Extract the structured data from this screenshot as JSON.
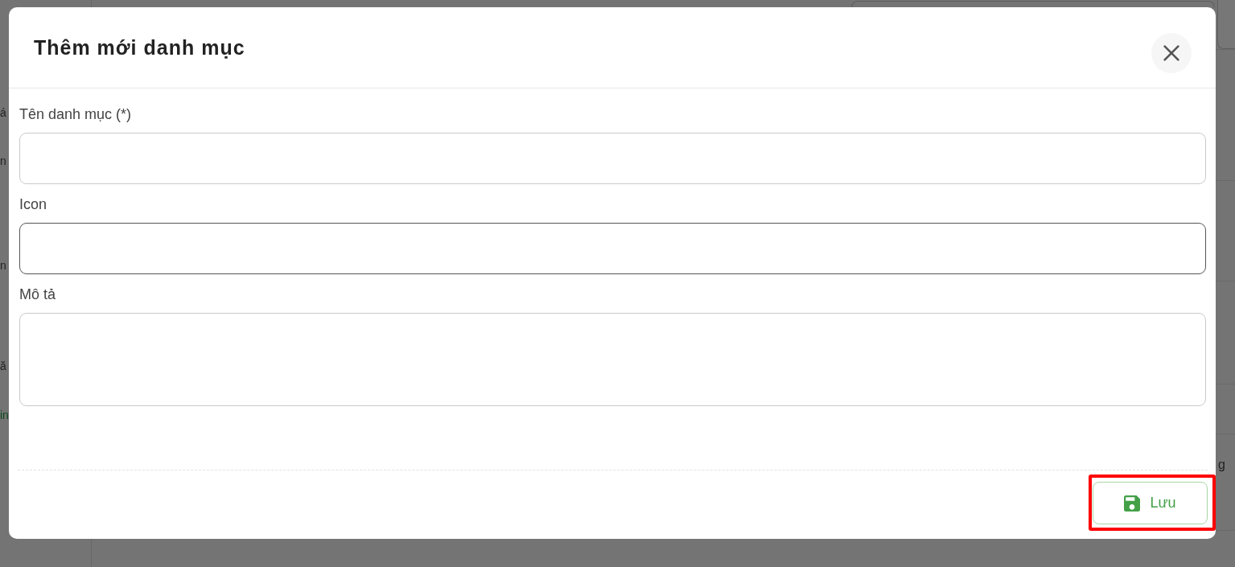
{
  "background": {
    "sidebar_fragments": [
      {
        "text": "á",
        "kind": "text"
      },
      {
        "text": "n",
        "kind": "text"
      },
      {
        "text": "n",
        "kind": "text"
      },
      {
        "text": "ă",
        "kind": "text"
      },
      {
        "text": "in",
        "kind": "link"
      }
    ],
    "table_fragments": [
      {
        "text": "g"
      }
    ]
  },
  "dialog": {
    "title": "Thêm mới danh mục"
  },
  "fields": [
    {
      "label": "Tên danh mục (*)",
      "kind": "text",
      "focused": false
    },
    {
      "label": "Icon",
      "kind": "text",
      "focused": true
    },
    {
      "label": "Mô tả",
      "kind": "textarea",
      "focused": false
    }
  ],
  "save_button": {
    "label": "Lưu",
    "highlighted": true
  }
}
